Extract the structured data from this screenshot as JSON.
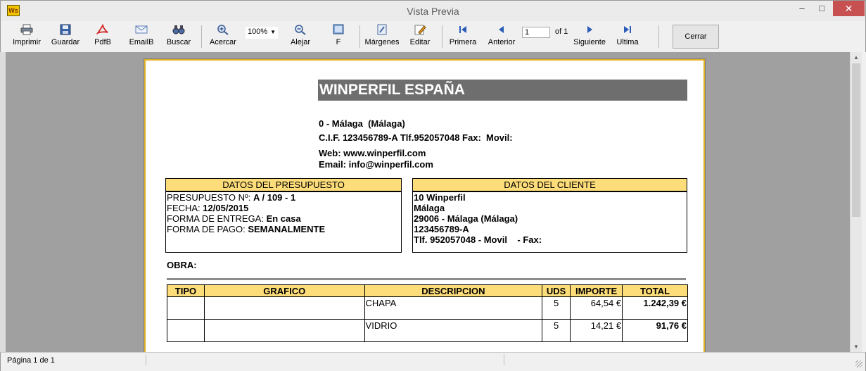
{
  "window": {
    "title": "Vista Previa",
    "icon_text": "Ws",
    "min_glyph": "–",
    "max_glyph": "□",
    "close_glyph": "✕"
  },
  "toolbar": {
    "imprimir": "Imprimir",
    "guardar": "Guardar",
    "pdfb": "PdfB",
    "emailb": "EmailB",
    "buscar": "Buscar",
    "acercar": "Acercar",
    "zoom": "100%",
    "alejar": "Alejar",
    "f": "F",
    "margenes": "Márgenes",
    "editar": "Editar",
    "primera": "Primera",
    "anterior": "Anterior",
    "page_value": "1",
    "page_of": "of 1",
    "siguiente": "Siguiente",
    "ultima": "Ultima",
    "cerrar": "Cerrar"
  },
  "report": {
    "company": "WINPERFIL ESPAÑA",
    "address1": "0 - Málaga  (Málaga)",
    "address2": "C.I.F. 123456789-A Tlf.952057048 Fax:  Movil:",
    "web": "Web: www.winperfil.com",
    "email": "Email: info@winperfil.com",
    "presupuesto": {
      "head": "DATOS DEL PRESUPUESTO",
      "num_label": "PRESUPUESTO Nº: ",
      "num_value": "A / 109 - 1",
      "fecha_label": "FECHA: ",
      "fecha_value": "12/05/2015",
      "entrega_label": "FORMA DE ENTREGA: ",
      "entrega_value": "En casa",
      "pago_label": "FORMA DE PAGO: ",
      "pago_value": "SEMANALMENTE"
    },
    "cliente": {
      "head": "DATOS DEL CLIENTE",
      "lines": [
        "10 Winperfil",
        "Málaga",
        "29006 - Málaga (Málaga)",
        "123456789-A",
        "Tlf. 952057048 - Movil    - Fax:"
      ]
    },
    "obra": "OBRA:",
    "columns": [
      "TIPO",
      "GRAFICO",
      "DESCRIPCION",
      "UDS",
      "IMPORTE",
      "TOTAL"
    ],
    "rows": [
      {
        "tipo": "",
        "grafico": "",
        "descripcion": "CHAPA",
        "uds": "5",
        "importe": "64,54 €",
        "total": "1.242,39 €"
      },
      {
        "tipo": "",
        "grafico": "",
        "descripcion": "VIDRIO",
        "uds": "5",
        "importe": "14,21 €",
        "total": "91,76 €"
      }
    ]
  },
  "status": {
    "page": "Página 1 de 1"
  },
  "colors": {
    "header_fill": "#fddc7a",
    "company_fill": "#6e6e6e",
    "page_border": "#e0b020",
    "close": "#c75050"
  }
}
